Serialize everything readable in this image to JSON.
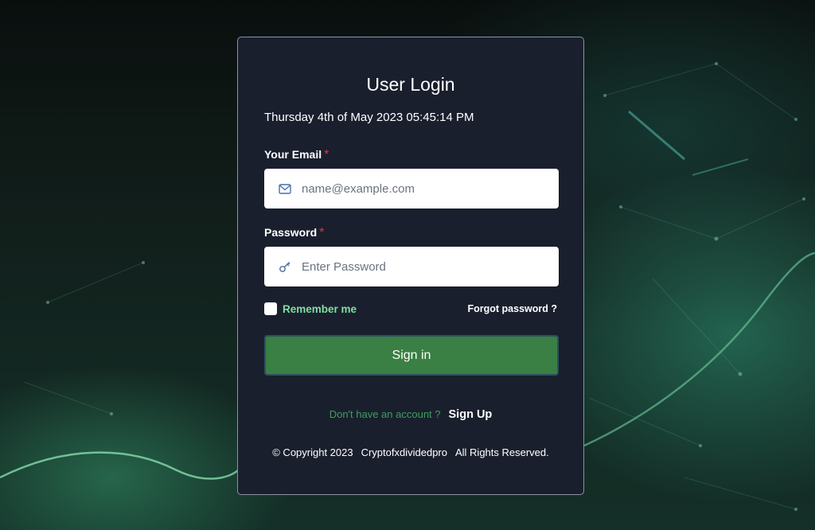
{
  "login": {
    "title": "User Login",
    "datetime": "Thursday 4th of May 2023 05:45:14 PM",
    "email": {
      "label": "Your Email",
      "required_mark": "*",
      "placeholder": "name@example.com",
      "icon": "mail-icon"
    },
    "password": {
      "label": "Password",
      "required_mark": "*",
      "placeholder": "Enter Password",
      "icon": "key-icon"
    },
    "remember_label": "Remember me",
    "forgot_label": "Forgot password ?",
    "signin_label": "Sign in",
    "no_account_text": "Don't have an account ?",
    "signup_label": "Sign Up"
  },
  "footer": {
    "copyright": "© Copyright 2023",
    "brand": "Cryptofxdividedpro",
    "rights": "All Rights Reserved."
  },
  "colors": {
    "card_bg": "#1a1f2e",
    "button_bg": "#3a7f43",
    "remember_text": "#7fdfa0",
    "no_account_text": "#3aa05a",
    "required": "#e0333c"
  }
}
